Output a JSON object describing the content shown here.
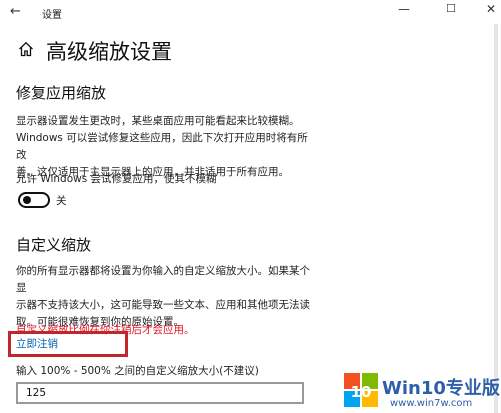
{
  "window": {
    "title": "设置",
    "back_glyph": "←",
    "min_glyph": "—",
    "max_glyph": "☐",
    "close_glyph": "✕"
  },
  "page": {
    "title": "高级缩放设置"
  },
  "fix_scaling": {
    "heading": "修复应用缩放",
    "description_lines": [
      "显示器设置发生更改时，某些桌面应用可能看起来比较模糊。",
      "Windows 可以尝试修复这些应用，因此下次打开应用时将有所改",
      "善。这仅适用于主显示器上的应用，并非适用于所有应用。"
    ],
    "toggle_caption": "允许 Windows 尝试修复应用，使其不模糊",
    "toggle_state": "关"
  },
  "custom_scaling": {
    "heading": "自定义缩放",
    "description_lines": [
      "你的所有显示器都将设置为你输入的自定义缩放大小。如果某个显",
      "示器不支持该大小，这可能导致一些文本、应用和其他项无法读",
      "取。可能很难恢复到你的原始设置。"
    ],
    "warning": "自定义缩放比例在你注销后才会应用。",
    "signout_link": "立即注销",
    "input_label": "输入 100% - 500% 之间的自定义缩放大小(不建议)",
    "input_value": "125"
  },
  "watermark": {
    "title": "Win10专业版",
    "url": "www.win7w.com",
    "logo_text": "10"
  },
  "colors": {
    "warning": "#e81123",
    "link": "#0063b1",
    "highlight_box": "#c0272d",
    "watermark_blue": "#2f5fa8"
  }
}
